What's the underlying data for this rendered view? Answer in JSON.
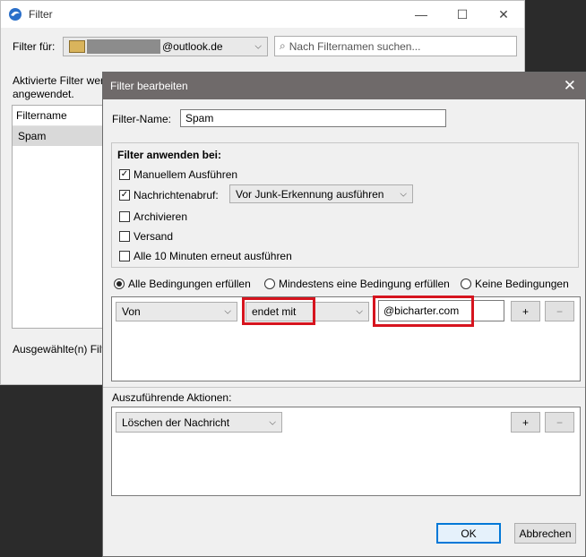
{
  "back_window": {
    "title": "Filter",
    "filter_for_label": "Filter für:",
    "account_suffix": "@outlook.de",
    "search_placeholder": "Nach Filternamen suchen...",
    "active_filters_text_line1": "Aktivierte Filter wer",
    "active_filters_text_line2": "angewendet.",
    "list_header": "Filtername",
    "list_item": "Spam",
    "selected_label": "Ausgewählte(n) Filt"
  },
  "dialog": {
    "title": "Filter bearbeiten",
    "name_label": "Filter-Name:",
    "name_value": "Spam",
    "apply_heading": "Filter anwenden bei:",
    "options": [
      {
        "label": "Manuellem Ausführen",
        "checked": true
      },
      {
        "label": "Nachrichtenabruf:",
        "checked": true
      },
      {
        "label": "Archivieren",
        "checked": false
      },
      {
        "label": "Versand",
        "checked": false
      },
      {
        "label": "Alle 10 Minuten erneut ausführen",
        "checked": false
      }
    ],
    "junk_select": "Vor Junk-Erkennung ausführen",
    "radio_all": "Alle Bedingungen erfüllen",
    "radio_any": "Mindestens eine Bedingung erfüllen",
    "radio_none": "Keine Bedingungen",
    "condition": {
      "field": "Von",
      "operator": "endet mit",
      "value": "@bicharter.com"
    },
    "plus": "+",
    "minus": "−",
    "actions_label": "Auszuführende Aktionen:",
    "action": "Löschen der Nachricht",
    "ok": "OK",
    "cancel": "Abbrechen"
  },
  "colors": {
    "highlight_border": "#d6141e",
    "dialog_titlebar": "#6f6a6a"
  }
}
